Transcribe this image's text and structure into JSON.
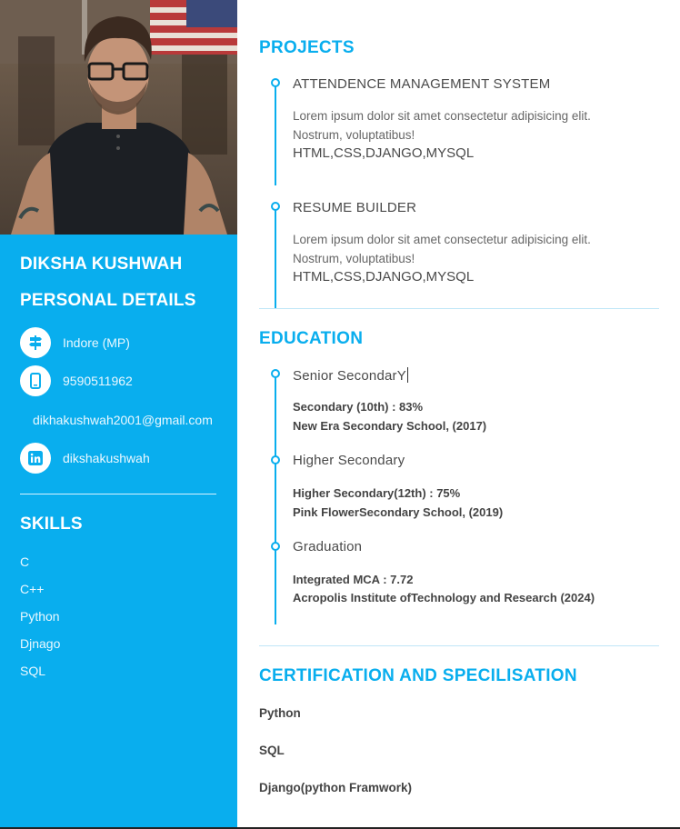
{
  "sidebar": {
    "name": "DIKSHA KUSHWAH",
    "personal_title": "PERSONAL DETAILS",
    "contacts": {
      "location": "Indore (MP)",
      "phone": "9590511962",
      "email": "dikhakushwah2001@gmail.com",
      "linkedin": "dikshakushwah"
    },
    "skills_title": "SKILLS",
    "skills": [
      "C",
      "C++",
      "Python",
      "Djnago",
      "SQL"
    ]
  },
  "projects": {
    "title": "PROJECTS",
    "items": [
      {
        "name": "ATTENDENCE MANAGEMENT SYSTEM",
        "desc1": "Lorem ipsum dolor sit amet consectetur adipisicing elit.",
        "desc2": "Nostrum, voluptatibus!",
        "tech": "HTML,CSS,DJANGO,MYSQL"
      },
      {
        "name": "RESUME BUILDER",
        "desc1": "Lorem ipsum dolor sit amet consectetur adipisicing elit.",
        "desc2": "Nostrum, voluptatibus!",
        "tech": "HTML,CSS,DJANGO,MYSQL"
      }
    ]
  },
  "education": {
    "title": "EDUCATION",
    "items": [
      {
        "name": "Senior SecondarY",
        "line1": "Secondary (10th) : 83%",
        "line2": "New Era Secondary School, (2017)"
      },
      {
        "name": "Higher Secondary",
        "line1": "Higher Secondary(12th) : 75%",
        "line2": "Pink FlowerSecondary School, (2019)"
      },
      {
        "name": "Graduation",
        "line1": "Integrated MCA : 7.72",
        "line2": "Acropolis Institute ofTechnology and Research (2024)"
      }
    ]
  },
  "certification": {
    "title": "CERTIFICATION AND SPECILISATION",
    "items": [
      "Python",
      "SQL",
      "Django(python Framwork)"
    ]
  },
  "colors": {
    "accent": "#09aeee",
    "text": "#4a4a4a"
  }
}
